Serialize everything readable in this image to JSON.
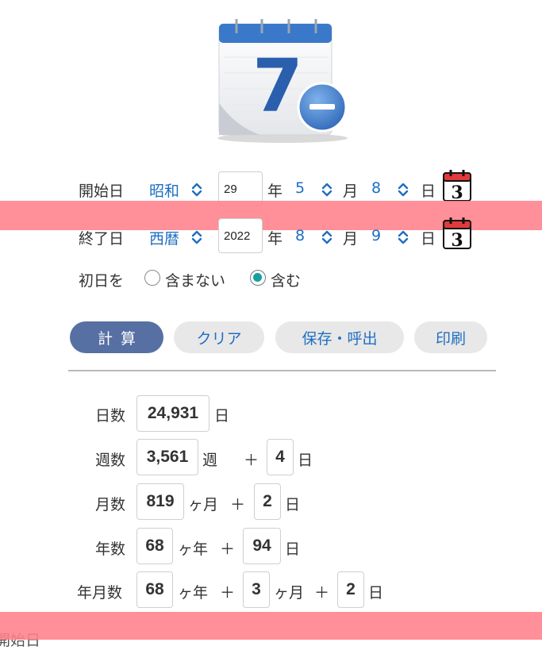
{
  "start": {
    "label": "開始日",
    "era": "昭和",
    "year": "29",
    "year_unit": "年",
    "month": "5",
    "month_unit": "月",
    "day": "8",
    "day_unit": "日",
    "calendar_icon_text": "3"
  },
  "end": {
    "label": "終了日",
    "era": "西暦",
    "year": "2022",
    "year_unit": "年",
    "month": "8",
    "month_unit": "月",
    "day": "9",
    "day_unit": "日",
    "calendar_icon_text": "3"
  },
  "first_day": {
    "label": "初日を",
    "options": [
      "含まない",
      "含む"
    ],
    "selected": "含む"
  },
  "buttons": {
    "calc": "計算",
    "clear": "クリア",
    "save_load": "保存・呼出",
    "print": "印刷"
  },
  "app_icon_text": "7",
  "results": {
    "days_label": "日数",
    "days_value": "24,931",
    "days_unit": "日",
    "weeks_label": "週数",
    "weeks_value": "3,561",
    "weeks_unit": "週",
    "weeks_plus": "＋",
    "weeks_rem": "4",
    "weeks_rem_unit": "日",
    "months_label": "月数",
    "months_value": "819",
    "months_unit": "ヶ月",
    "months_plus": "＋",
    "months_rem": "2",
    "months_rem_unit": "日",
    "years_label": "年数",
    "years_value": "68",
    "years_unit": "ヶ年",
    "years_plus": "＋",
    "years_rem": "94",
    "years_rem_unit": "日",
    "ymd_label": "年月数",
    "ymd_years": "68",
    "ymd_years_unit": "ヶ年",
    "ymd_plus1": "＋",
    "ymd_months": "3",
    "ymd_months_unit": "ヶ月",
    "ymd_plus2": "＋",
    "ymd_days": "2",
    "ymd_days_unit": "日"
  },
  "footer_partial": "開始日",
  "colors": {
    "accent": "#1f6fc0",
    "primary_button": "#5770a3",
    "band": "#ff7f8a",
    "radio_selected": "#16a0a0"
  }
}
